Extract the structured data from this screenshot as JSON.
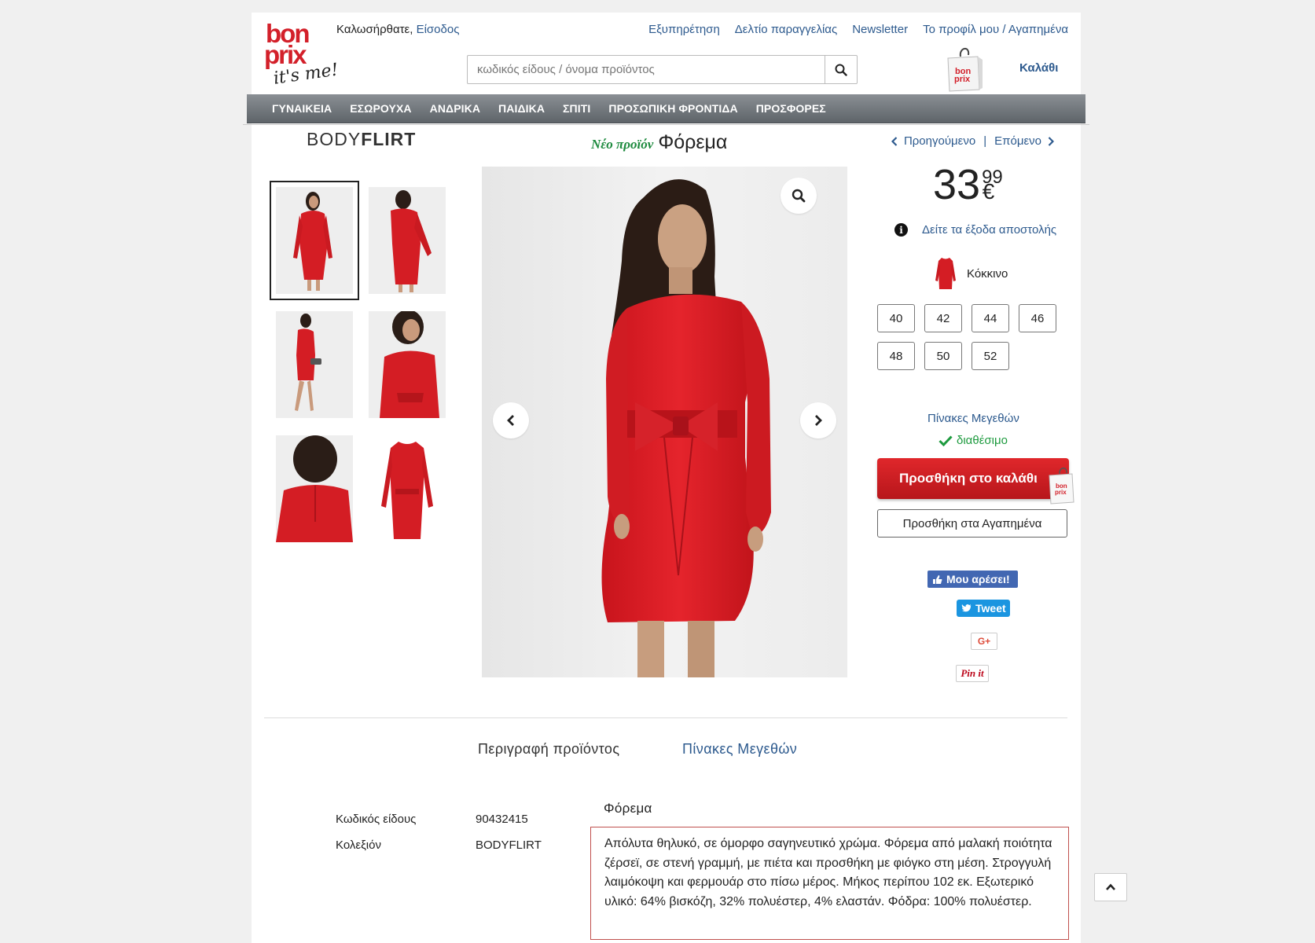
{
  "header": {
    "logo_alt": "bonprix it's me!",
    "greeting": "Καλωσήρθατε,",
    "login_link": "Είσοδος",
    "top_links": [
      "Εξυπηρέτηση",
      "Δελτίο παραγγελίας",
      "Newsletter",
      "Το προφίλ μου / Αγαπημένα"
    ],
    "search_placeholder": "κωδικός είδους / όνομα προϊόντος",
    "cart_label": "Καλάθι"
  },
  "nav": [
    "ΓΥΝΑΙΚΕΙΑ",
    "ΕΣΩΡΟΥΧΑ",
    "ΑΝΔΡΙΚΑ",
    "ΠΑΙΔΙΚΑ",
    "ΣΠΙΤΙ",
    "ΠΡΟΣΩΠΙΚΗ ΦΡΟΝΤΙΔΑ",
    "ΠΡΟΣΦΟΡΕΣ"
  ],
  "product": {
    "brand_light": "BODY",
    "brand_bold": "FLIRT",
    "new_tag": "Νέο προϊόν",
    "title": "Φόρεμα",
    "prev": "Προηγούμενο",
    "separator": "|",
    "next": "Επόμενο",
    "price_int": "33",
    "price_dec": "99",
    "currency": "€",
    "shipping": "Δείτε τα έξοδα αποστολής",
    "color": "Κόκκινο",
    "sizes": [
      "40",
      "42",
      "44",
      "46",
      "48",
      "50",
      "52"
    ],
    "size_tables": "Πίνακες Μεγεθών",
    "availability": "διαθέσιμο",
    "add_to_cart": "Προσθήκη στο καλάθι",
    "add_to_fav": "Προσθήκη στα Αγαπημένα",
    "accent_color": "#d3202a"
  },
  "social": {
    "facebook": "Μου αρέσει!",
    "twitter": "Tweet",
    "googleplus": "G+",
    "pinterest": "Pin it"
  },
  "tabs": [
    "Περιγραφή προϊόντος",
    "Πίνακες Μεγεθών"
  ],
  "details": [
    {
      "label": "Κωδικός είδους",
      "value": "90432415"
    },
    {
      "label": "Κολεξιόν",
      "value": "BODYFLIRT"
    }
  ],
  "description": {
    "title": "Φόρεμα",
    "text": "Απόλυτα θηλυκό, σε όμορφο σαγηνευτικό χρώμα. Φόρεμα από μαλακή ποιότητα ζέρσεϊ, σε στενή γραμμή, με πιέτα και προσθήκη με φιόγκο στη μέση. Στρογγυλή λαιμόκοψη και φερμουάρ στο πίσω μέρος. Μήκος περίπου 102 εκ. Εξωτερικό υλικό: 64% βισκόζη, 32% πολυέστερ, 4% ελαστάν. Φόδρα: 100% πολυέστερ."
  }
}
